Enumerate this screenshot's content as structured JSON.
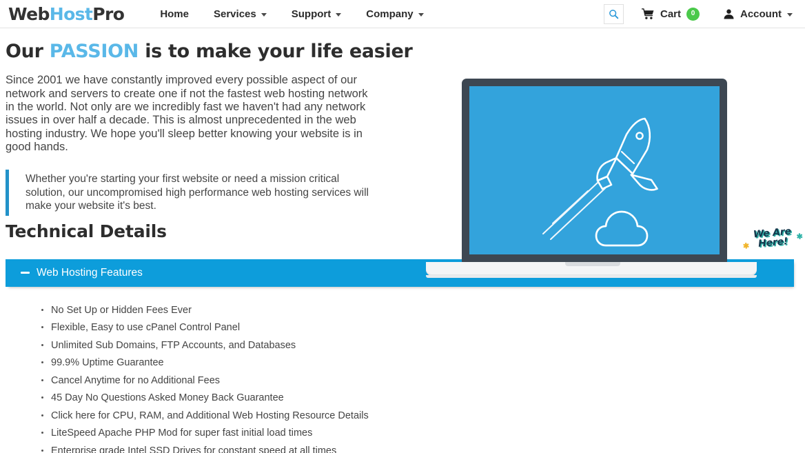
{
  "header": {
    "logo": {
      "part1": "Web",
      "part2": "Host",
      "part3": "Pro"
    },
    "nav": [
      {
        "label": "Home",
        "has_caret": false
      },
      {
        "label": "Services",
        "has_caret": true
      },
      {
        "label": "Support",
        "has_caret": true
      },
      {
        "label": "Company",
        "has_caret": true
      }
    ],
    "search_icon": "search-icon",
    "cart": {
      "label": "Cart",
      "count": "0",
      "badge_color": "#4bc94b"
    },
    "account": {
      "label": "Account",
      "has_caret": true
    }
  },
  "hero": {
    "title_pre": "Our ",
    "title_highlight": "PASSION",
    "title_post": " is to make your life easier",
    "highlight_color": "#5ab8e8",
    "paragraph": "Since 2001 we have constantly improved every possible aspect of our network and servers to create one if not the fastest web hosting network in the world. Not only are we incredibly fast we haven't had any network issues in over half a decade. This is almost unprecedented in the web hosting industry. We hope you'll sleep better knowing your website is in good hands.",
    "quote": "Whether you're starting your first website or need a mission critical solution, our uncompromised high performance web hosting services will make your website it's best.",
    "quote_border_color": "#2292c9",
    "illustration": {
      "name": "laptop-rocket-illustration",
      "screen_color": "#33a3dc",
      "bezel_color": "#3d4752",
      "badge_line1": "We Are",
      "badge_line2": "Here!",
      "badge_text_color": "#16394d",
      "badge_shadow_color": "#2fb3a8"
    }
  },
  "technical": {
    "heading": "Technical Details",
    "accordion": {
      "title": "Web Hosting Features",
      "expanded": true,
      "bar_color": "#0d9ddb",
      "toggle_icon": "minus-icon"
    },
    "features": [
      "No Set Up or Hidden Fees Ever",
      "Flexible, Easy to use cPanel Control Panel",
      "Unlimited Sub Domains, FTP Accounts, and Databases",
      "99.9% Uptime Guarantee",
      "Cancel Anytime for no Additional Fees",
      "45 Day No Questions Asked Money Back Guarantee",
      "Click here for CPU, RAM, and Additional Web Hosting Resource Details",
      "LiteSpeed Apache PHP Mod for super fast initial load times",
      "Enterprise grade Intel SSD Drives for constant speed at all times"
    ]
  }
}
